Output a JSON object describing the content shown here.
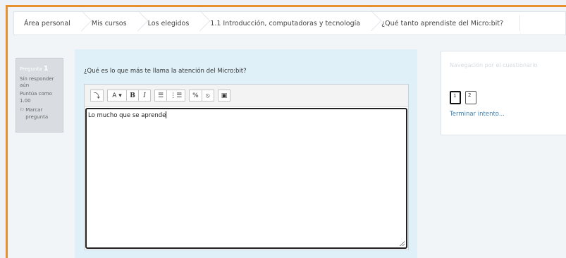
{
  "breadcrumb": {
    "items": [
      "Área personal",
      "Mis cursos",
      "Los elegidos",
      "1.1 Introducción, computadoras y tecnología",
      "¿Qué tanto aprendiste del Micro:bit?"
    ]
  },
  "question_info": {
    "label": "Pregunta",
    "number": "1",
    "status": "Sin responder aún",
    "grade": "Puntúa como 1.00",
    "flag_icon": "flag-icon",
    "flag_label": "Marcar pregunta"
  },
  "question": {
    "text": "¿Qué es lo que más te llama la atención del Micro:bit?",
    "answer": "Lo mucho que se aprende"
  },
  "toolbar": {
    "collapse": "⤵",
    "font": "A ▾",
    "bold": "B",
    "italic": "I",
    "unordered_list": "☰",
    "ordered_list": "⋮☰",
    "link": "%",
    "unlink": "⦸",
    "image": "▣"
  },
  "quiz_nav": {
    "title": "Navegación por el cuestionario",
    "buttons": [
      "1",
      "2"
    ],
    "finish": "Terminar intento..."
  },
  "colors": {
    "frame_accent": "#e8902e",
    "question_bg": "#dff0f8",
    "info_bg": "#d9dde2",
    "link": "#3b7fb0"
  }
}
